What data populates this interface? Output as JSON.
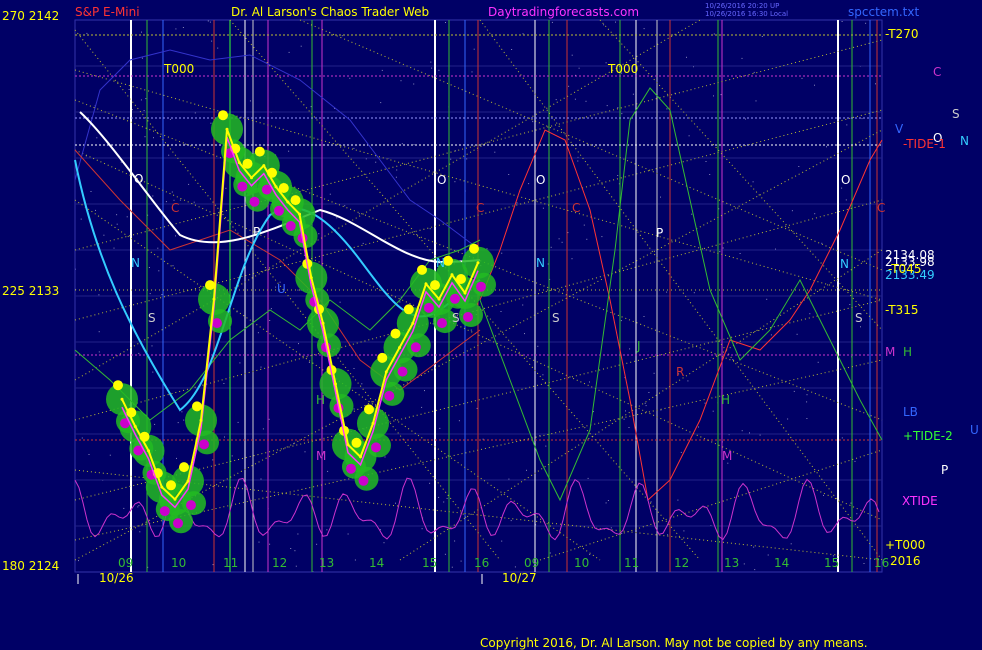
{
  "header": {
    "left_price": "270  2142",
    "instrument": "S&P E-Mini",
    "site_title": "Dr. Al Larson's Chaos Trader Web",
    "url": "Daytradingforecasts.com",
    "stamp1": "10/26/2016 20:20 UP",
    "stamp2": "10/26/2016 16:30 Local",
    "file": "spcctem.txt"
  },
  "yaxis": {
    "top": "270  2142",
    "mid": "225  2133",
    "bottom": "180  2124"
  },
  "xaxis": {
    "hours_day1": [
      "09",
      "10",
      "11",
      "12",
      "13",
      "14",
      "15",
      "16"
    ],
    "hours_day2": [
      "09",
      "10",
      "11",
      "12",
      "13",
      "14",
      "15",
      "16"
    ],
    "date1": "10/26",
    "date2": "10/27"
  },
  "right_labels": {
    "t270": "-T270",
    "c": "C",
    "s": "S",
    "v": "V",
    "o": "O",
    "n": "N",
    "tide1": "-TIDE-1",
    "p1": "2134.08",
    "p2": "2133.98",
    "p3": "2133.49",
    "t045": "-T045",
    "t315": "-T315",
    "m": "M",
    "h": "H",
    "lb": "LB",
    "tide2": "+TIDE-2",
    "u": "U",
    "p": "P",
    "xtide": "XTIDE",
    "t000": "+T000",
    "y2016": "2016"
  },
  "plot_labels": {
    "t000_a": "T000",
    "t000_b": "T000",
    "o1": "O",
    "o2": "O",
    "o3": "O",
    "o4": "O",
    "n1": "N",
    "n2": "N",
    "n3": "N",
    "n4": "N",
    "s1": "S",
    "s2": "S",
    "s3": "S",
    "s4": "S",
    "c1": "C",
    "c2": "C",
    "c3": "C",
    "c4": "C",
    "p1": "P",
    "p2": "P",
    "h1": "H",
    "h2": "H",
    "m1": "M",
    "m2": "M",
    "u1": "U",
    "j1": "J",
    "r1": "R"
  },
  "footer": {
    "copyright": "Copyright 2016, Dr. Al Larson. May not be copied by any means."
  },
  "colors": {
    "background": "#000066",
    "price": "#ffff00",
    "price_pink": "#ff33ff",
    "green_blob": "#22bb22",
    "cyan": "#33ccff",
    "white_avg": "#ffffff",
    "red": "#ff3333",
    "green_line": "#33bb33",
    "magenta": "#cc33cc",
    "dotted_yellow": "#bbbb33"
  },
  "chart_data": {
    "type": "line",
    "title": "S&P E-Mini",
    "ylim": [
      2124,
      2142
    ],
    "yticks": [
      2124,
      2133,
      2142
    ],
    "series": [
      {
        "name": "S&P E-Mini",
        "x": [
          "09:00",
          "09:15",
          "09:30",
          "09:45",
          "10:00",
          "10:15",
          "10:30",
          "10:45",
          "11:00",
          "11:15",
          "11:30",
          "11:45",
          "12:00",
          "12:15",
          "12:30",
          "12:45",
          "13:00",
          "13:15",
          "13:30",
          "13:45",
          "14:00",
          "14:15",
          "14:30",
          "14:45",
          "15:00",
          "15:15",
          "15:30",
          "15:45",
          "16:00"
        ],
        "values": [
          2129.5,
          2128.6,
          2127.8,
          2126.6,
          2126.2,
          2126.8,
          2128.8,
          2132.8,
          2138.4,
          2137.3,
          2136.8,
          2137.2,
          2136.5,
          2136.0,
          2135.6,
          2133.5,
          2132.0,
          2130.0,
          2128.0,
          2127.6,
          2128.7,
          2130.4,
          2131.2,
          2132.0,
          2133.3,
          2132.8,
          2133.6,
          2133.0,
          2134.0
        ]
      }
    ]
  }
}
